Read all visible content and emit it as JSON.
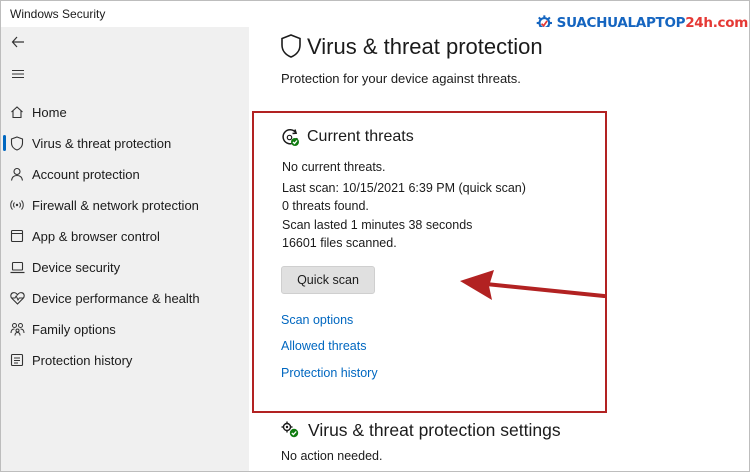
{
  "window": {
    "title": "Windows Security"
  },
  "watermark": {
    "brand": "SUACHUALAPTOP",
    "brand_suffix": "24h.com",
    "color_main": "#1565c0",
    "color_suffix": "#e53935"
  },
  "sidebar": {
    "back_icon": "back-arrow-icon",
    "menu_icon": "hamburger-menu-icon",
    "items": [
      {
        "label": "Home",
        "icon": "home-icon",
        "active": false
      },
      {
        "label": "Virus & threat protection",
        "icon": "shield-icon",
        "active": true
      },
      {
        "label": "Account protection",
        "icon": "person-icon",
        "active": false
      },
      {
        "label": "Firewall & network protection",
        "icon": "wifi-icon",
        "active": false
      },
      {
        "label": "App & browser control",
        "icon": "browser-window-icon",
        "active": false
      },
      {
        "label": "Device security",
        "icon": "laptop-icon",
        "active": false
      },
      {
        "label": "Device performance & health",
        "icon": "heart-pulse-icon",
        "active": false
      },
      {
        "label": "Family options",
        "icon": "family-icon",
        "active": false
      },
      {
        "label": "Protection history",
        "icon": "history-icon",
        "active": false
      }
    ]
  },
  "main": {
    "title": "Virus & threat protection",
    "subtitle": "Protection for your device against threats.",
    "current_threats": {
      "title": "Current threats",
      "lines": [
        "No current threats.",
        "Last scan: 10/15/2021 6:39 PM (quick scan)",
        "0 threats found.",
        "Scan lasted 1 minutes 38 seconds",
        "16601 files scanned."
      ],
      "quick_scan_label": "Quick scan",
      "links": [
        "Scan options",
        "Allowed threats",
        "Protection history"
      ]
    },
    "settings": {
      "title": "Virus & threat protection settings",
      "status": "No action needed."
    }
  },
  "annotation": {
    "highlight_color": "#b22222",
    "arrow_color": "#b22222"
  }
}
